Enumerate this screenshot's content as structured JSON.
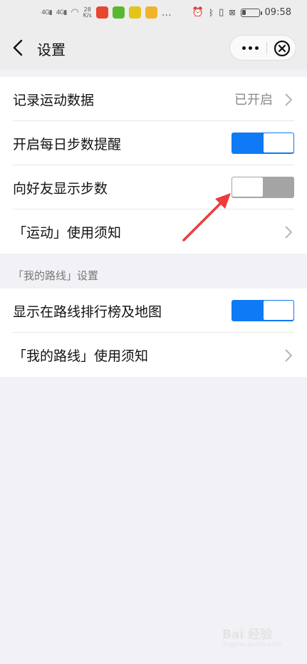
{
  "status_bar": {
    "signal_1": "4G",
    "signal_2": "4G",
    "net_speed_value": "28",
    "net_speed_unit": "K/s",
    "time": "09:58",
    "icons": [
      "signal-icon",
      "wifi-icon",
      "alarm-icon",
      "bluetooth-icon",
      "vibrate-icon",
      "battery-icon"
    ],
    "app_icon_colors": [
      "#e8462d",
      "#5ab82f",
      "#e5c41a"
    ]
  },
  "nav": {
    "title": "设置",
    "more_icon": "more-dots-icon",
    "close_icon": "close-circle-icon"
  },
  "group_1": {
    "rows": [
      {
        "label": "记录运动数据",
        "value": "已开启",
        "type": "link"
      },
      {
        "label": "开启每日步数提醒",
        "type": "toggle",
        "on": true
      },
      {
        "label": "向好友显示步数",
        "type": "toggle",
        "on": false
      },
      {
        "label": "「运动」使用须知",
        "type": "link"
      }
    ]
  },
  "section_2": {
    "header": "「我的路线」设置",
    "rows": [
      {
        "label": "显示在路线排行榜及地图",
        "type": "toggle",
        "on": true
      },
      {
        "label": "「我的路线」使用须知",
        "type": "link"
      }
    ]
  },
  "colors": {
    "toggle_on": "#0f7af5",
    "toggle_off": "#a4a4a4",
    "arrow": "#ee3b3b",
    "background": "#f2f1f6"
  },
  "watermark": {
    "logo": "Bai 经验",
    "sub": "jingyan.baidu.com"
  }
}
